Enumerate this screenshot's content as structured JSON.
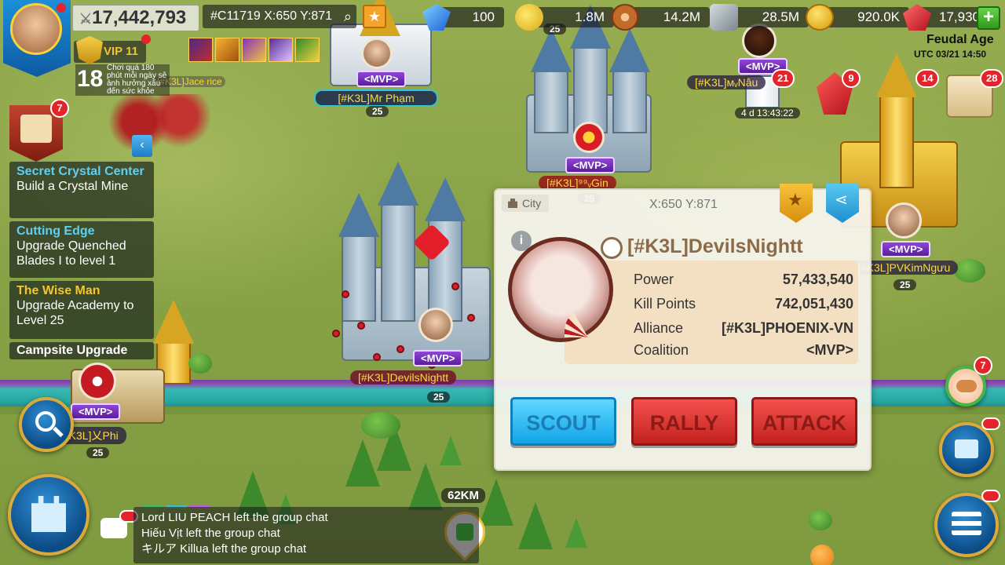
{
  "topbar": {
    "power": "17,442,793",
    "coords": "#C11719 X:650 Y:871",
    "resources": [
      {
        "name": "gems",
        "value": "100",
        "color": "#2a6fe0"
      },
      {
        "name": "food",
        "value": "1.8M",
        "color": "#e4c12b"
      },
      {
        "name": "wood",
        "value": "14.2M",
        "color": "#b5652b"
      },
      {
        "name": "stone",
        "value": "28.5M",
        "color": "#9aa3ab"
      },
      {
        "name": "gold",
        "value": "920.0K",
        "color": "#e7b419"
      },
      {
        "name": "crystal",
        "value": "17,930",
        "color": "#d3212c"
      }
    ],
    "vip": "VIP 11",
    "age": "Feudal Age",
    "utc": "UTC 03/21 14:50"
  },
  "age_warning": {
    "number": "18",
    "lines": [
      "Chơi quá 180",
      "phút mỗi ngày sẽ",
      "ảnh hưởng xấu",
      "đến sức khỏe"
    ]
  },
  "quests": [
    {
      "title": "Secret Crystal Center",
      "desc": "Build a Crystal Mine",
      "color": "#5fd0f0"
    },
    {
      "title": "Cutting Edge",
      "desc": "Upgrade Quenched Blades I to level 1",
      "color": "#5fd0f0"
    },
    {
      "title": "The Wise Man",
      "desc": "Upgrade Academy to Level 25",
      "color": "#f5c531"
    },
    {
      "title": "Campsite Upgrade",
      "desc": "",
      "color": "#ffffff"
    }
  ],
  "badges": {
    "quest_scroll": "7",
    "red_21": "21",
    "red_9": "9",
    "red_14": "14",
    "red_28": "28",
    "alliance_help": "7"
  },
  "map": {
    "timer": "4 d 13:43:22",
    "distance": "62KM",
    "mvp_tag": "<MVP>",
    "players": [
      {
        "name": "[#K3L]Mr Phạm",
        "level": "25"
      },
      {
        "name": "[#K3L]⁹⁹ᵥGin",
        "level": "25"
      },
      {
        "name": "[#K3L]DevilsNightt",
        "level": "25"
      },
      {
        "name": "[#K3L]PVKimNgưu",
        "level": "25"
      },
      {
        "name": "[#K3L]乂Phi",
        "level": "25"
      },
      {
        "name": "[#K3L]ᴍᵥNâu",
        "level": ""
      },
      {
        "name": "[#K3L]Jace rice",
        "level": ""
      }
    ],
    "top_level": "25"
  },
  "popup": {
    "tag": "City",
    "coords": "X:650 Y:871",
    "name": "[#K3L]DevilsNightt",
    "stats": [
      {
        "label": "Power",
        "value": "57,433,540"
      },
      {
        "label": "Kill Points",
        "value": "742,051,430"
      },
      {
        "label": "Alliance",
        "value": "[#K3L]PHOENIX-VN"
      },
      {
        "label": "Coalition",
        "value": "<MVP>"
      }
    ],
    "buttons": {
      "scout": "SCOUT",
      "rally": "RALLY",
      "attack": "ATTACK"
    }
  },
  "chat": {
    "messages": [
      "Lord LIU PEACH left the group chat",
      "Hiếu Vịt left the group chat",
      "キルア Killua left the group chat"
    ]
  }
}
